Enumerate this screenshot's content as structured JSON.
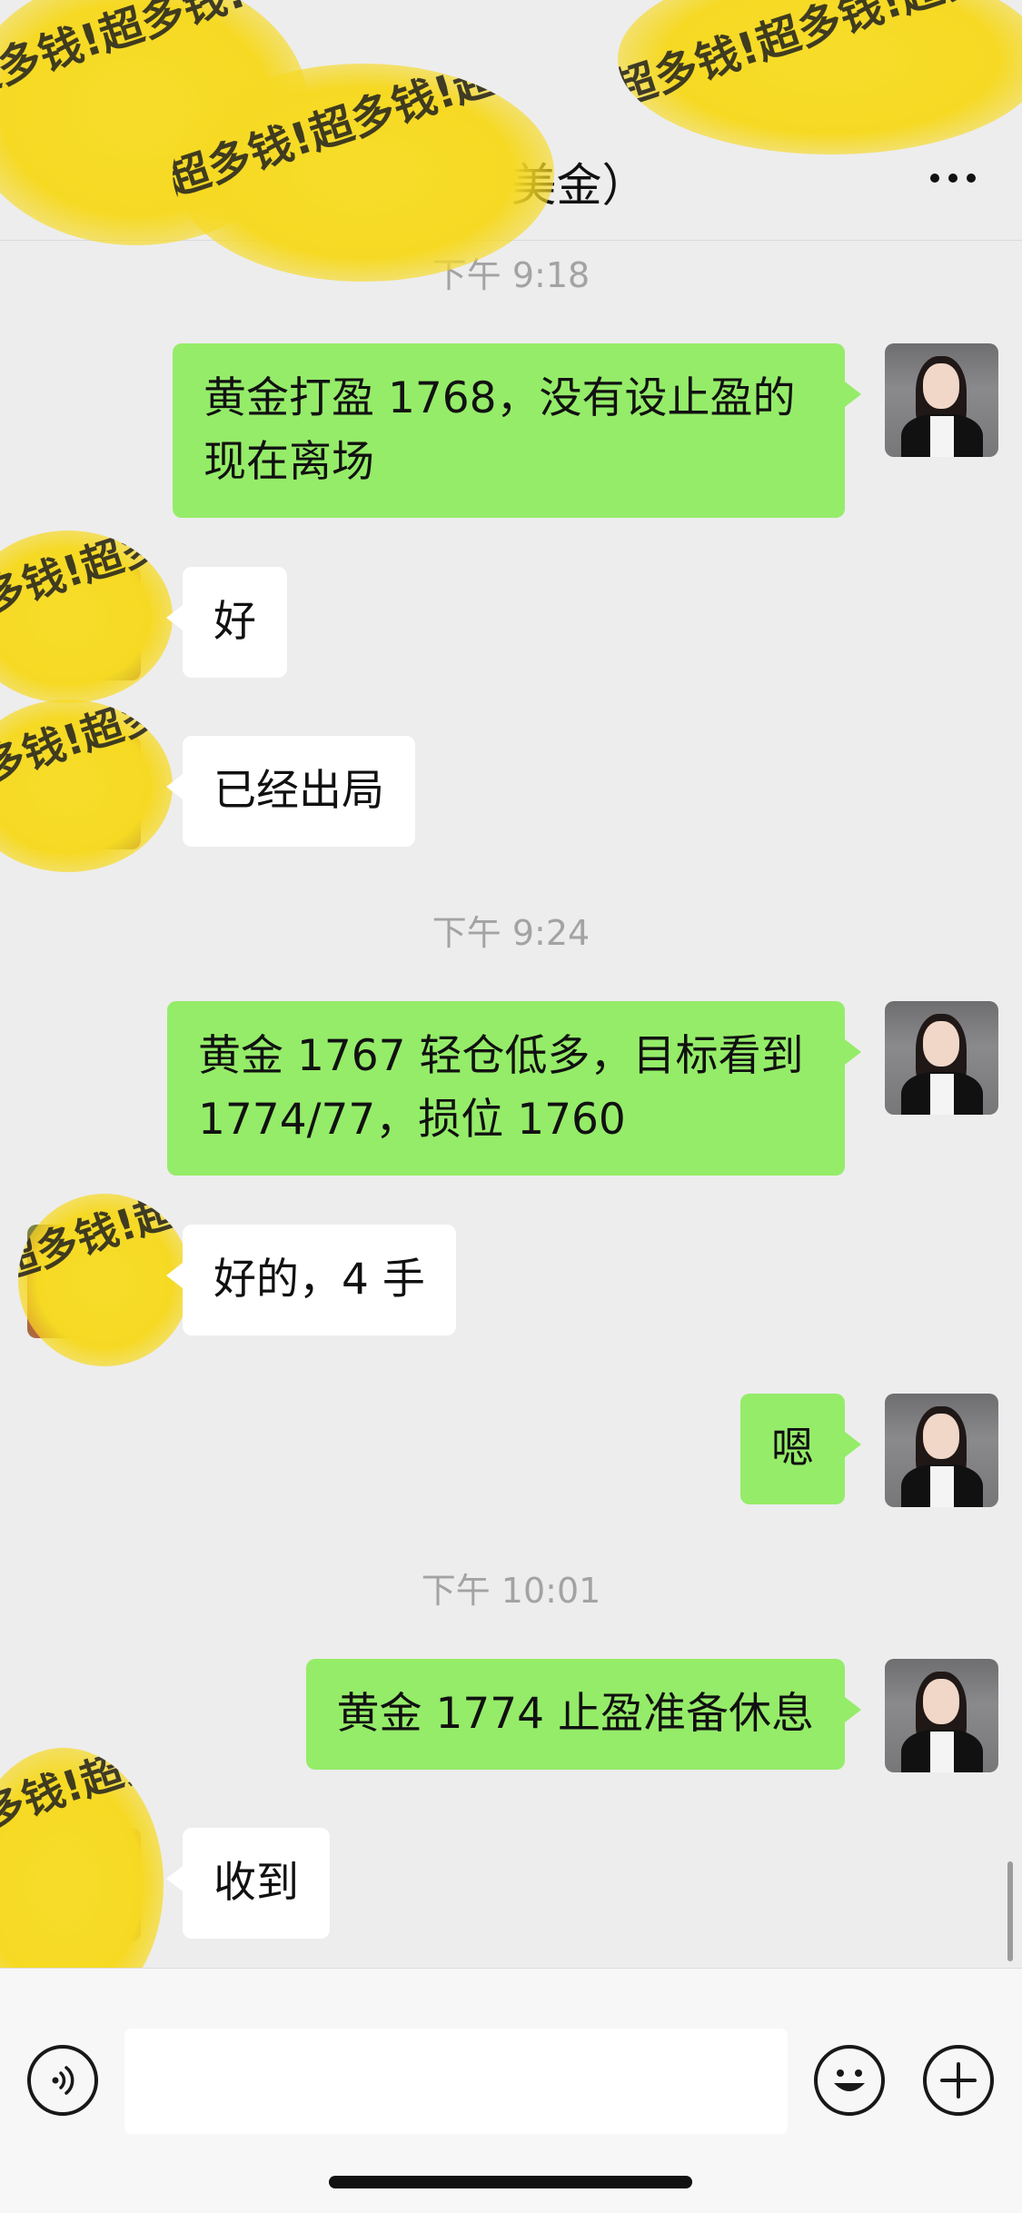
{
  "header": {
    "title": "万美金）"
  },
  "watermark": {
    "text": "超多钱!超多钱!超多钱!",
    "color": "#f6d923"
  },
  "colors": {
    "outgoing_bubble": "#95ec69",
    "incoming_bubble": "#ffffff",
    "background": "#ededed"
  },
  "messages": {
    "time_1": "下午 9:18",
    "m1": "黄金打盈 1768，没有设止盈的现在离场",
    "m2": "好",
    "m3": "已经出局",
    "time_2": "下午 9:24",
    "m4": "黄金 1767 轻仓低多，目标看到 1774/77，损位 1760",
    "m5": "好的，4 手",
    "m6": "嗯",
    "time_3": "下午 10:01",
    "m7": "黄金 1774 止盈准备休息",
    "m8": "收到"
  },
  "input_bar": {
    "voice_icon": "voice-icon",
    "emoji_icon": "emoji-icon",
    "plus_icon": "plus-icon",
    "placeholder": ""
  }
}
